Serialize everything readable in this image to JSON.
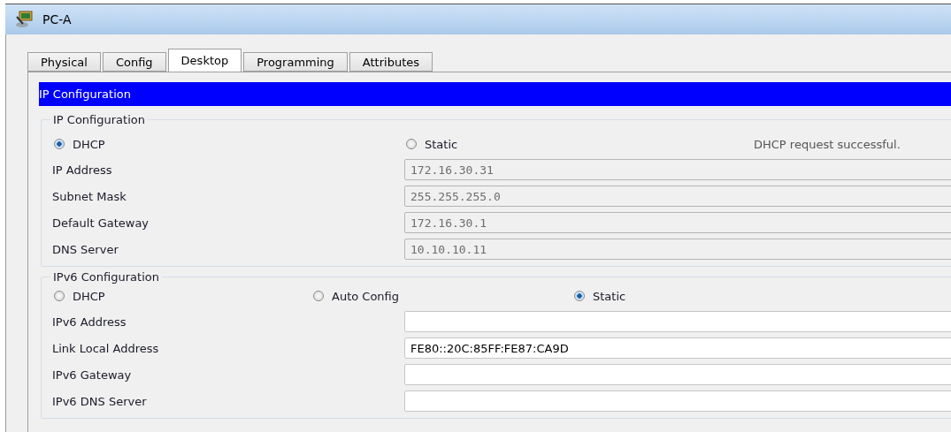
{
  "window": {
    "title": "PC-A"
  },
  "tabs": [
    {
      "label": "Physical",
      "selected": false
    },
    {
      "label": "Config",
      "selected": false
    },
    {
      "label": "Desktop",
      "selected": true
    },
    {
      "label": "Programming",
      "selected": false
    },
    {
      "label": "Attributes",
      "selected": false
    }
  ],
  "panel": {
    "title": "IP Configuration"
  },
  "ipv4": {
    "title": "IP Configuration",
    "status": "DHCP request successful.",
    "modes": [
      {
        "label": "DHCP",
        "selected": true
      },
      {
        "label": "Static",
        "selected": false
      }
    ],
    "fields": [
      {
        "label": "IP Address",
        "value": "172.16.30.31",
        "disabled": true
      },
      {
        "label": "Subnet Mask",
        "value": "255.255.255.0",
        "disabled": true
      },
      {
        "label": "Default Gateway",
        "value": "172.16.30.1",
        "disabled": true
      },
      {
        "label": "DNS Server",
        "value": "10.10.10.11",
        "disabled": true
      }
    ]
  },
  "ipv6": {
    "title": "IPv6 Configuration",
    "modes": [
      {
        "label": "DHCP",
        "selected": false
      },
      {
        "label": "Auto Config",
        "selected": false
      },
      {
        "label": "Static",
        "selected": true
      }
    ],
    "fields": [
      {
        "label": "IPv6 Address",
        "disabled": false
      },
      {
        "label": "Link Local Address",
        "value": "FE80::20C:85FF:FE87:CA9D",
        "disabled": false
      },
      {
        "label": "IPv6 Gateway",
        "disabled": false
      },
      {
        "label": "IPv6 DNS Server",
        "disabled": false
      }
    ]
  }
}
